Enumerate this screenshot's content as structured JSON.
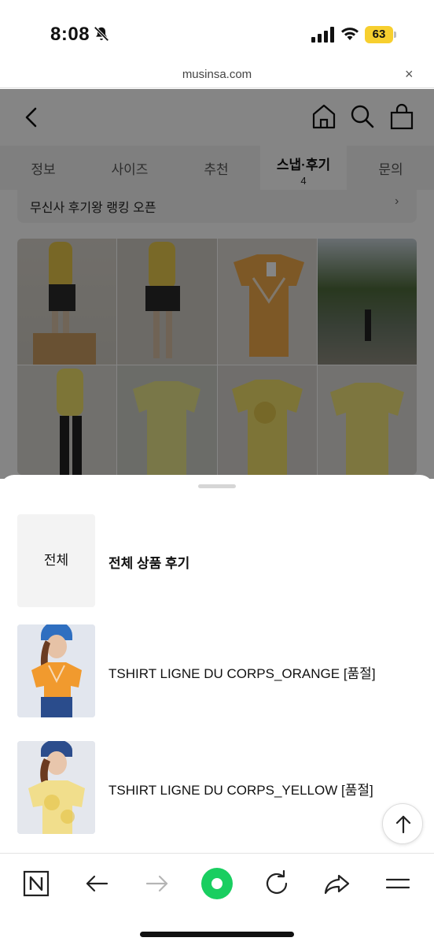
{
  "status_bar": {
    "time": "8:08",
    "battery": "63"
  },
  "url_bar": {
    "domain": "musinsa.com",
    "close_symbol": "×"
  },
  "tabs": [
    {
      "label": "정보"
    },
    {
      "label": "사이즈"
    },
    {
      "label": "추천"
    },
    {
      "label": "스냅·후기",
      "count": "4",
      "active": true
    },
    {
      "label": "문의"
    }
  ],
  "banner": {
    "text": "무신사 후기왕 랭킹 오픈"
  },
  "sheet": {
    "items": [
      {
        "thumb_text": "전체",
        "label": "전체 상품 후기"
      },
      {
        "label": "TSHIRT LIGNE DU CORPS_ORANGE [품절]"
      },
      {
        "label": "TSHIRT LIGNE DU CORPS_YELLOW [품절]"
      }
    ]
  },
  "icons": {
    "back": "chevron-left-icon",
    "home": "home-icon",
    "search": "search-icon",
    "cart": "shopping-bag-icon",
    "scroll_top": "arrow-up-icon",
    "toolbar": [
      "naver-n-icon",
      "back-arrow-icon",
      "forward-arrow-icon",
      "green-dot-icon",
      "refresh-icon",
      "share-icon",
      "menu-icon"
    ]
  },
  "colors": {
    "accent_green": "#19ce60",
    "battery_yellow": "#f7cf2f"
  }
}
